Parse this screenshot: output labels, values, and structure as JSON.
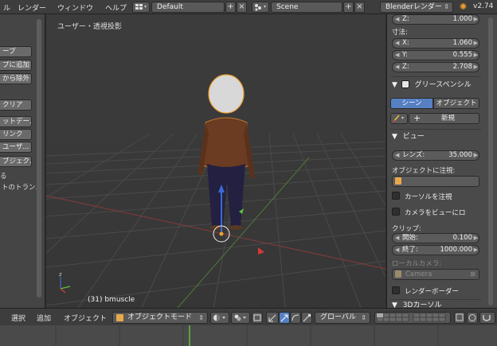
{
  "topbar": {
    "menus": [
      "ル",
      "レンダー",
      "ウィンドウ",
      "ヘルプ"
    ],
    "screen_layout": "Default",
    "scene": "Scene",
    "render_engine": "Blenderレンダー",
    "version": "v2.74"
  },
  "left_panel": {
    "buttons": [
      "ープ",
      "プに追加",
      "から除外",
      "クリア",
      "ットデー...",
      "リンク",
      "ユーザ...",
      "ブジェク..."
    ],
    "texts": [
      "る",
      "トのトランス"
    ]
  },
  "viewport": {
    "view_label": "ユーザー・透視投影",
    "object_label": "(31) bmuscle"
  },
  "right_panel": {
    "top_field": {
      "label": "Z:",
      "value": "1.000"
    },
    "dimensions_label": "寸法:",
    "dimensions": [
      {
        "label": "X:",
        "value": "1.060"
      },
      {
        "label": "Y:",
        "value": "0.555"
      },
      {
        "label": "Z:",
        "value": "2.708"
      }
    ],
    "grease_pencil": {
      "title": "グリースペンシル",
      "tab_scene": "シーン",
      "tab_object": "オブジェクト",
      "new_button": "新規"
    },
    "view": {
      "title": "ビュー",
      "lens_label": "レンズ:",
      "lens_value": "35.000",
      "lock_object_label": "オブジェクトに注視:",
      "lock_cursor": "カーソルを注視",
      "lock_camera": "カメラをビューにロ",
      "clip_label": "クリップ:",
      "clip_start_label": "開始:",
      "clip_start_value": "0.100",
      "clip_end_label": "終了:",
      "clip_end_value": "1000.000",
      "local_camera_label": "ローカルカメラ:",
      "local_camera_value": "Camera",
      "render_border": "レンダーボーダー"
    },
    "cursor_section_title": "3Dカーソル"
  },
  "bottombar": {
    "menus": [
      "選択",
      "追加",
      "オブジェクト"
    ],
    "mode": "オブジェクトモード",
    "orientation": "グローバル"
  },
  "colors": {
    "accent_blue": "#5680c2",
    "selection_orange": "#f0a030",
    "axis_red": "#d43a3a",
    "axis_green": "#6ab23a"
  }
}
